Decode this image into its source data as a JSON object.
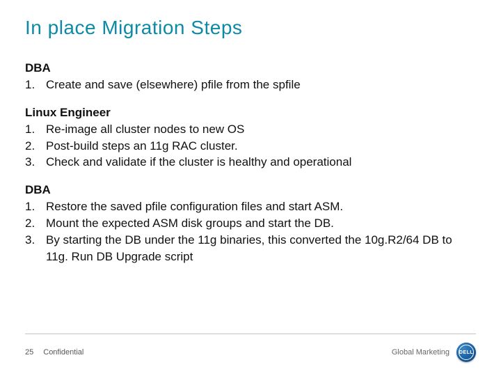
{
  "title": "In place Migration Steps",
  "sections": [
    {
      "heading": "DBA",
      "items": [
        {
          "num": "1.",
          "text": "Create and save (elsewhere) pfile from the spfile"
        }
      ]
    },
    {
      "heading": "Linux Engineer",
      "items": [
        {
          "num": "1.",
          "text": "Re-image all cluster nodes to new OS"
        },
        {
          "num": "2.",
          "text": "Post-build steps an 11g RAC cluster."
        },
        {
          "num": "3.",
          "text": "Check and validate if the cluster is healthy and operational"
        }
      ]
    },
    {
      "heading": "DBA",
      "items": [
        {
          "num": "1.",
          "text": "Restore the saved pfile configuration files and start ASM."
        },
        {
          "num": "2.",
          "text": "Mount the expected ASM disk groups and start the DB."
        },
        {
          "num": "3.",
          "text": "By starting the DB under the 11g binaries, this converted the 10g.R2/64 DB to 11g.  Run DB Upgrade script"
        }
      ]
    }
  ],
  "footer": {
    "page": "25",
    "confidential": "Confidential",
    "right_text": "Global Marketing",
    "logo_text": "DELL"
  }
}
